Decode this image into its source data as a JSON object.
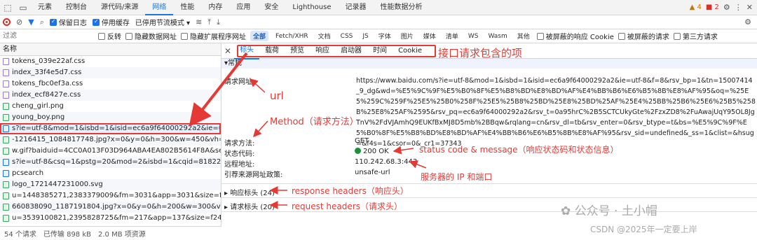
{
  "tabs": [
    "元素",
    "控制台",
    "源代码/来源",
    "网络",
    "性能",
    "内存",
    "应用",
    "安全",
    "Lighthouse",
    "记录器",
    "性能数据分析"
  ],
  "active_tab": "网络",
  "warnings": "4",
  "errors": "2",
  "toolbar": {
    "preserve_log": "保留日志",
    "disable_cache": "停用缓存",
    "throttle": "已停用节流模式"
  },
  "filter": {
    "placeholder": "过滤",
    "invert": "反转",
    "hide_data_urls": "隐藏数据网址",
    "hide_ext_urls": "隐藏扩展程序网址",
    "chips": [
      "全部",
      "Fetch/XHR",
      "文档",
      "CSS",
      "JS",
      "字体",
      "图片",
      "媒体",
      "清单",
      "WS",
      "Wasm",
      "其他"
    ],
    "blocked_cookies": "被屏蔽的响应 Cookie",
    "blocked_requests": "被屏蔽的请求",
    "third_party": "第三方请求"
  },
  "list": {
    "header": "名称",
    "rows": [
      {
        "name": "tokens_039e22af.css",
        "type": "css"
      },
      {
        "name": "index_33f4e5d7.css",
        "type": "css"
      },
      {
        "name": "tokens_fbc0ef3a.css",
        "type": "css"
      },
      {
        "name": "index_ecf8427e.css",
        "type": "css"
      },
      {
        "name": "cheng_girl.png",
        "type": "img"
      },
      {
        "name": "young_boy.png",
        "type": "img"
      },
      {
        "name": "s?ie=utf-8&mod=1&isbd=1&isid=ec6a9f64000292a2&ie=u...efined...",
        "type": "doc"
      },
      {
        "name": "-1216415_1084817748.jpg?x=0&y=0&h=300&w=450&vh=300.00&...",
        "type": "img"
      },
      {
        "name": "w.gif?baiduid=4CC0A013F03D964ABA4EA802B5614F8A&sea...14...",
        "type": "img"
      },
      {
        "name": "s?ie=utf-8&csq=1&pstg=20&mod=2&isbd=1&cqid=81822d9...69.1...",
        "type": "doc"
      },
      {
        "name": "pcsearch",
        "type": "doc"
      },
      {
        "name": "logo_1721447231000.svg",
        "type": "img"
      },
      {
        "name": "u=1448385271,2383379009&fm=3031&app=3031&size=f242...",
        "type": "img"
      },
      {
        "name": "660838090_1187191804.jpg?x=0&y=0&h=200&w=300&vh=200.00...",
        "type": "img"
      },
      {
        "name": "u=3539100821,2395828725&fm=217&app=137&size=f242,1...sec=...",
        "type": "img"
      }
    ],
    "selected_index": 6
  },
  "status": {
    "requests": "54 个请求",
    "transferred": "已传输 898 kB",
    "resources": "2.0 MB 项资源"
  },
  "detail": {
    "tabs": [
      "标头",
      "载荷",
      "预览",
      "响应",
      "启动器",
      "时间",
      "Cookie"
    ],
    "active": "标头",
    "general": "▾常规",
    "request_url_label": "请求网址:",
    "request_url": "https://www.baidu.com/s?ie=utf-8&mod=1&isbd=1&isid=ec6a9f64000292a2&ie=utf-8&f=8&rsv_bp=1&tn=15007414_9_dg&wd=%E5%9C%9F%E5%B0%8F%E5%B8%BD%E8%BD%AF%E4%BB%B6%E6%B5%8B%E8%AF%95&oq=%25E5%259C%259F%25E5%25B0%258F%25E5%25B8%25BD%25E8%25BD%25AF%25E4%25BB%25B6%25E6%25B5%258B%25E8%25AF%2595&rsv_pq=ec6a9f64000292a2&rsv_t=0a95hrC%2B5SCTCUkyGte%2FzxZD8%2FuAwajUqY95OL8JgTnV%2FdVJAmhQ9EUKfBxMJ8D5mb%2BBqw&rqlang=cn&rsv_dl=tb&rsv_enter=0&rsv_btype=t&bs=%E5%9C%9F%E5%B0%8F%E5%B8%BD%E8%BD%AF%E4%BB%B6%E6%B5%8B%E8%AF%95&rsv_sid=undefined&_ss=1&clist=&hsug=&f4s=1&csor=0&_cr1=37343",
    "method_label": "请求方法:",
    "method": "GET",
    "status_label": "状态代码:",
    "status_code": "200 OK",
    "remote_label": "远程地址:",
    "remote": "110.242.68.3:443",
    "referrer_label": "引荐来源网址政策:",
    "referrer": "unsafe-url",
    "response_headers": "▸ 响应标头 (24)",
    "request_headers": "▸ 请求标头 (20)"
  },
  "annotations": {
    "items": "接口请求包含的项",
    "url": "url",
    "method": "Method（请求方法）",
    "status": "status code & message（响应状态码和状态信息）",
    "server": "服务器的 IP 和端口",
    "resp": "response headers（响应头）",
    "req": "request headers（请求头）",
    "annotation_color": "#e53935"
  },
  "watermark": {
    "wechat": "公众号 · 土小帽",
    "csdn": "CSDN @2025年一定要上岸"
  }
}
